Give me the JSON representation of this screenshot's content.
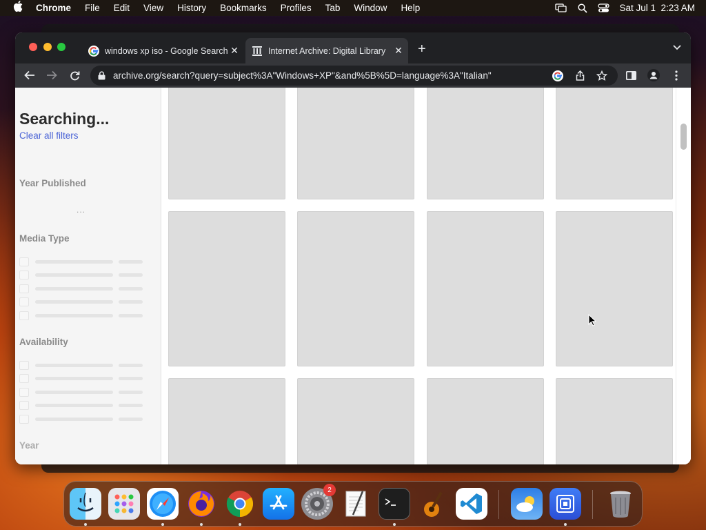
{
  "menubar": {
    "app_name": "Chrome",
    "items": [
      "File",
      "Edit",
      "View",
      "History",
      "Bookmarks",
      "Profiles",
      "Tab",
      "Window",
      "Help"
    ],
    "clock": "Sat Jul 1  2:23 AM"
  },
  "browser": {
    "tabs": [
      {
        "title": "windows xp iso - Google Search",
        "favicon": "google-icon",
        "active": false
      },
      {
        "title": "Internet Archive: Digital Library",
        "favicon": "archive-icon",
        "active": true
      }
    ],
    "url": "archive.org/search?query=subject%3A\"Windows+XP\"&and%5B%5D=language%3A\"Italian\""
  },
  "sidebar": {
    "title": "Searching...",
    "clear_filters": "Clear all filters",
    "facets": {
      "year_published": "Year Published",
      "media_type": "Media Type",
      "availability": "Availability",
      "year": "Year"
    },
    "loading_indicator": "..."
  },
  "dock": {
    "apps": [
      "Finder",
      "Launchpad",
      "Safari",
      "Firefox",
      "Chrome",
      "App Store",
      "System Settings",
      "TextEdit",
      "Terminal",
      "GarageBand",
      "Visual Studio Code",
      "Weather",
      "Screen Sharing",
      "Trash"
    ],
    "settings_badge": "2"
  }
}
